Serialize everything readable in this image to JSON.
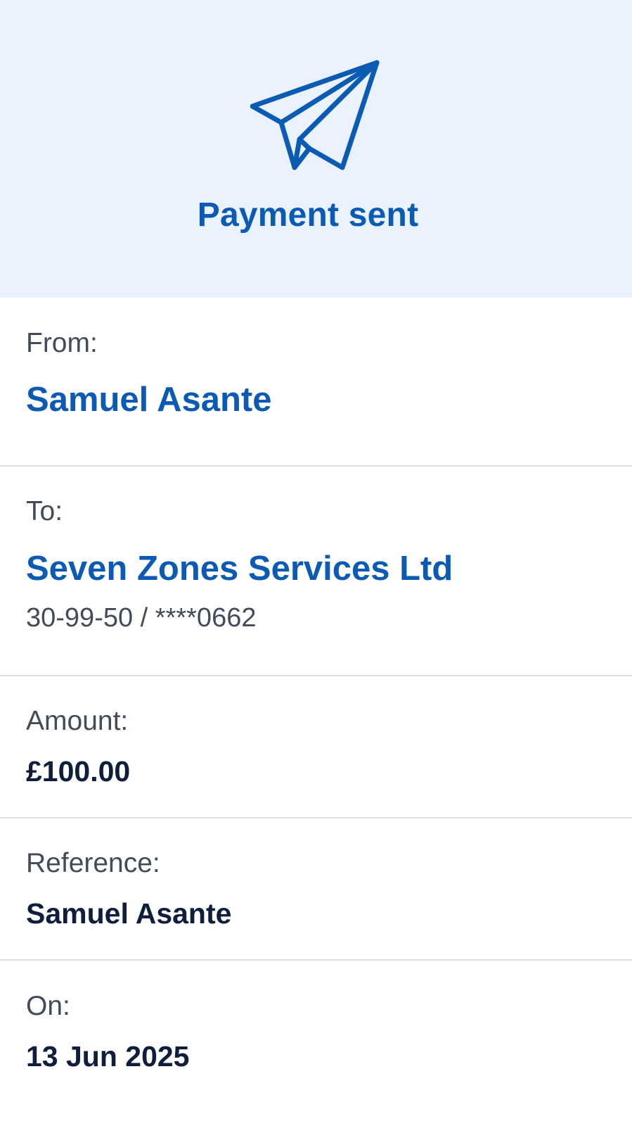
{
  "header": {
    "icon": "paper-plane-icon",
    "title": "Payment sent",
    "accent_color": "#0b5bb5",
    "background_color": "#eaf3fd"
  },
  "details": {
    "from": {
      "label": "From:",
      "value": "Samuel Asante"
    },
    "to": {
      "label": "To:",
      "value": "Seven Zones Services Ltd",
      "account": "30-99-50 / ****0662"
    },
    "amount": {
      "label": "Amount:",
      "value": "£100.00"
    },
    "reference": {
      "label": "Reference:",
      "value": "Samuel Asante"
    },
    "on": {
      "label": "On:",
      "value": "13 Jun 2025"
    }
  }
}
